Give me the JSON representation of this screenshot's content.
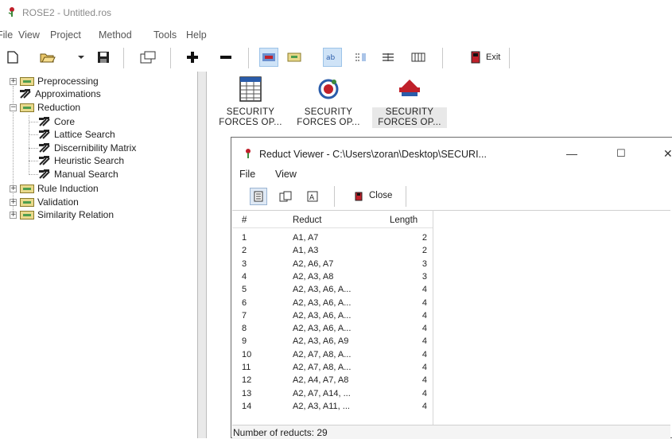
{
  "app": {
    "title": "ROSE2 - Untitled.ros"
  },
  "menubar": [
    "File",
    "View",
    "Project",
    "Method",
    "Tools",
    "Help"
  ],
  "toolbar": {
    "buttons": [
      "new-icon",
      "open-icon",
      "dropdown-icon",
      "save-icon",
      "properties-icon",
      "add-icon",
      "remove-icon",
      "view-large-icon",
      "view-small-icon",
      "view-list-icon",
      "view-details-icon",
      "view-columns-icon",
      "view-table-icon"
    ],
    "exit_label": "Exit"
  },
  "tree": {
    "items": [
      {
        "label": "Preprocessing",
        "kind": "folder",
        "expander": "+"
      },
      {
        "label": "Approximations",
        "kind": "tool"
      },
      {
        "label": "Reduction",
        "kind": "folder",
        "expander": "−"
      },
      {
        "label": "Core",
        "kind": "tool"
      },
      {
        "label": "Lattice Search",
        "kind": "tool"
      },
      {
        "label": "Discernibility Matrix",
        "kind": "tool"
      },
      {
        "label": "Heuristic Search",
        "kind": "tool"
      },
      {
        "label": "Manual Search",
        "kind": "tool"
      },
      {
        "label": "Rule Induction",
        "kind": "folder",
        "expander": "+"
      },
      {
        "label": "Validation",
        "kind": "folder",
        "expander": "+"
      },
      {
        "label": "Similarity Relation",
        "kind": "folder",
        "expander": "+"
      }
    ]
  },
  "workspace": {
    "items": [
      {
        "line1": "SECURITY",
        "line2": "FORCES OP...",
        "icon": "table-icon"
      },
      {
        "line1": "SECURITY",
        "line2": "FORCES OP...",
        "icon": "reduct-icon"
      },
      {
        "line1": "SECURITY",
        "line2": "FORCES OP...",
        "icon": "rules-icon"
      }
    ]
  },
  "viewer": {
    "title": "Reduct Viewer - C:\\Users\\zoran\\Desktop\\SECURI...",
    "menu": [
      "File",
      "View"
    ],
    "close_label": "Close",
    "columns": [
      "#",
      "Reduct",
      "Length"
    ],
    "rows": [
      {
        "n": "1",
        "reduct": "A1, A7",
        "length": "2"
      },
      {
        "n": "2",
        "reduct": "A1, A3",
        "length": "2"
      },
      {
        "n": "3",
        "reduct": "A2, A6, A7",
        "length": "3"
      },
      {
        "n": "4",
        "reduct": "A2, A3, A8",
        "length": "3"
      },
      {
        "n": "5",
        "reduct": "A2, A3, A6, A...",
        "length": "4"
      },
      {
        "n": "6",
        "reduct": "A2, A3, A6, A...",
        "length": "4"
      },
      {
        "n": "7",
        "reduct": "A2, A3, A6, A...",
        "length": "4"
      },
      {
        "n": "8",
        "reduct": "A2, A3, A6, A...",
        "length": "4"
      },
      {
        "n": "9",
        "reduct": "A2, A3, A6, A9",
        "length": "4"
      },
      {
        "n": "10",
        "reduct": "A2, A7, A8, A...",
        "length": "4"
      },
      {
        "n": "11",
        "reduct": "A2, A7, A8, A...",
        "length": "4"
      },
      {
        "n": "12",
        "reduct": "A2, A4, A7, A8",
        "length": "4"
      },
      {
        "n": "13",
        "reduct": "A2, A7, A14, ...",
        "length": "4"
      },
      {
        "n": "14",
        "reduct": "A2, A3, A11, ...",
        "length": "4"
      }
    ],
    "status": "Number of reducts: 29"
  },
  "colors": {
    "selection": "#cfe3f7",
    "folder": "#e9d98b",
    "icon_red": "#c0202a",
    "icon_blue": "#2a5caa"
  }
}
